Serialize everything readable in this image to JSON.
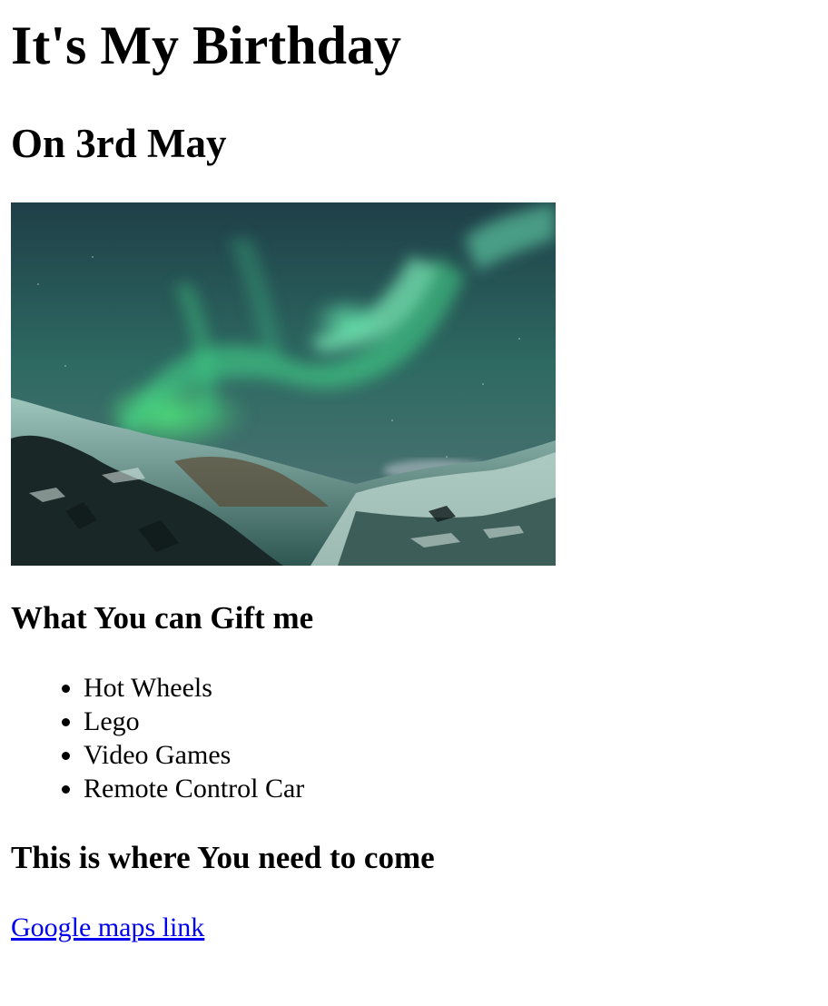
{
  "header": {
    "title": "It's My Birthday",
    "subtitle": "On 3rd May"
  },
  "image": {
    "alt": "Northern lights over snowy hills",
    "colors": {
      "sky_top": "#1e3a3f",
      "sky_mid": "#2f6a60",
      "aurora": "#49e07f",
      "horizon": "#6f7f8a",
      "snow": "#cfe3dd",
      "rock": "#1c2a2a"
    }
  },
  "gifts": {
    "heading": "What You can Gift me",
    "items": [
      "Hot Wheels",
      "Lego",
      "Video Games",
      "Remote Control Car"
    ]
  },
  "location": {
    "heading": "This is where You need to come",
    "link_label": "Google maps link",
    "link_color": "#0000ee"
  }
}
